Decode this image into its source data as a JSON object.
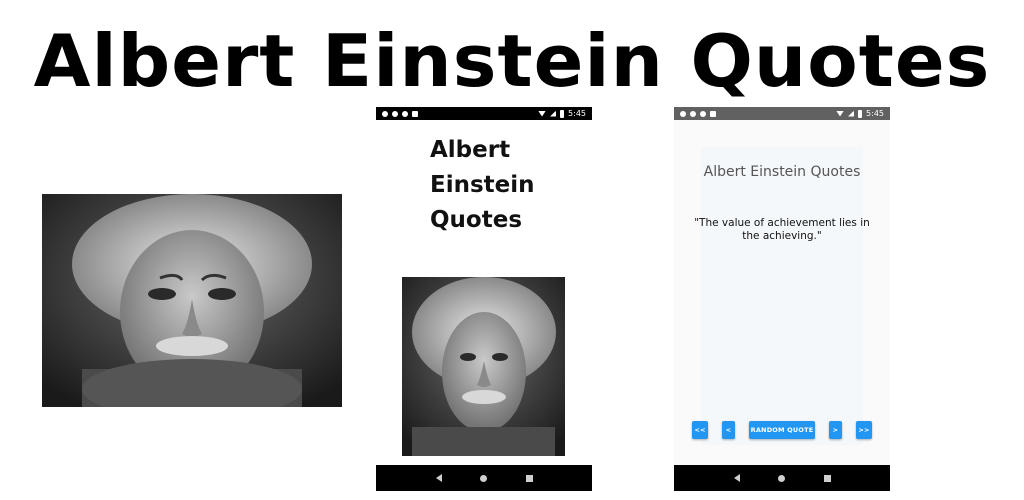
{
  "banner": {
    "title": "Albert Einstein Quotes"
  },
  "phone1": {
    "status_time": "5:45",
    "app_title_lines": [
      "Albert",
      "Einstein",
      "Quotes"
    ]
  },
  "phone2": {
    "status_time": "5:45",
    "app_title": "Albert Einstein Quotes",
    "quote": "\"The value of achievement lies in the achieving.\"",
    "buttons": {
      "first": "<<",
      "prev": "<",
      "random": "RANDOM QUOTE",
      "next": ">",
      "last": ">>"
    }
  },
  "colors": {
    "button_blue": "#2196f3",
    "status_dark": "#000000",
    "status_gray": "#616161",
    "nav_bar": "#000000"
  },
  "icons": [
    "gear-icon",
    "shield-icon",
    "circle-icon",
    "lock-icon",
    "wifi-icon",
    "signal-icon",
    "battery-icon",
    "back-icon",
    "home-icon",
    "recents-icon"
  ]
}
